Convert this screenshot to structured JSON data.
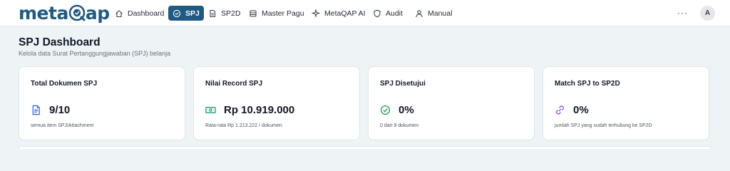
{
  "app": {
    "logo_prefix": "meta",
    "logo_suffix": "ap",
    "brand_color": "#1f5a82"
  },
  "nav": {
    "items": [
      {
        "label": "Dashboard",
        "icon": "home-icon",
        "active": false
      },
      {
        "label": "SPJ",
        "icon": "check-circle-icon",
        "active": true
      },
      {
        "label": "SP2D",
        "icon": "document-icon",
        "active": false
      },
      {
        "label": "Master Pagu",
        "icon": "database-icon",
        "active": false
      },
      {
        "label": "MetaQAP AI",
        "icon": "sparkles-icon",
        "active": false
      },
      {
        "label": "Audit",
        "icon": "shield-icon",
        "active": false
      },
      {
        "label": "Manual",
        "icon": "user-icon",
        "active": false
      }
    ],
    "more_label": "···",
    "avatar_initial": "A"
  },
  "page": {
    "title": "SPJ Dashboard",
    "subtitle": "Kelola data Surat Pertanggungjawaban (SPJ) belanja"
  },
  "cards": [
    {
      "title": "Total Dokumen SPJ",
      "value": "9/10",
      "note": "semua item SPJ/Attachment",
      "icon": "document-icon",
      "color": "#2563eb"
    },
    {
      "title": "Nilai Record SPJ",
      "value": "Rp 10.919.000",
      "note": "Rata-rata Rp 1.213.222 / dokumen",
      "icon": "banknote-icon",
      "color": "#059669"
    },
    {
      "title": "SPJ Disetujui",
      "value": "0%",
      "note": "0 dari 9 dokumen",
      "icon": "check-circle-icon",
      "color": "#16a34a"
    },
    {
      "title": "Match SPJ to SP2D",
      "value": "0%",
      "note": "jumlah SPJ yang sudah terhubung ke SP2D",
      "icon": "link-icon",
      "color": "#7c3aed"
    }
  ]
}
